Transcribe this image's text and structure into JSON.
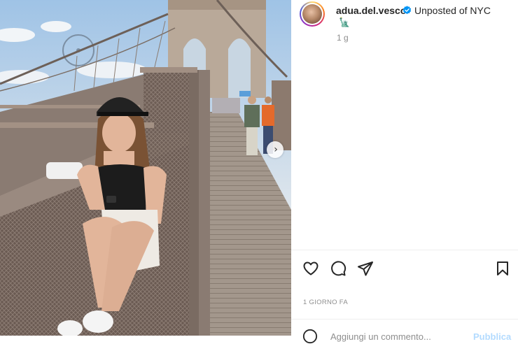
{
  "post": {
    "username": "adua.del.vesco",
    "caption": "Unposted of NYC",
    "caption_emoji": "🗽",
    "time_ago": "1 g",
    "date_label": "1 GIORNO FA",
    "verified": true
  },
  "comment_box": {
    "placeholder": "Aggiungi un commento...",
    "publish_label": "Pubblica"
  },
  "icons": {
    "like": "heart-icon",
    "comment": "comment-icon",
    "share": "paper-plane-icon",
    "save": "bookmark-icon",
    "next": "chevron-right-icon",
    "verified": "verified-badge-icon",
    "emoji": "smiley-icon"
  },
  "colors": {
    "verified_blue": "#0095f6",
    "muted_text": "#8e8e8e",
    "divider": "#efefef"
  }
}
